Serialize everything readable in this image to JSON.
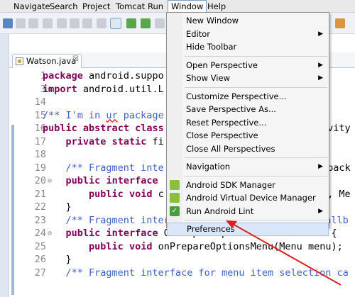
{
  "menubar": {
    "items": [
      "Navigate",
      "Search",
      "Project",
      "Tomcat",
      "Run",
      "Window",
      "Help"
    ],
    "active": "Window"
  },
  "editor": {
    "tab_label": "Watson.java",
    "tab_close": "☒",
    "lines": [
      {
        "num": "1",
        "text": "package android.suppo",
        "fold": ""
      },
      {
        "num": "3",
        "text": "import android.util.L",
        "fold": "⊕"
      },
      {
        "num": "14",
        "text": "",
        "fold": ""
      },
      {
        "num": "15",
        "text": "/** I'm in ur package",
        "fold": ""
      },
      {
        "num": "16",
        "text": "public abstract class",
        "fold": ""
      },
      {
        "num": "17",
        "text": "    private static fi",
        "fold": ""
      },
      {
        "num": "18",
        "text": "",
        "fold": ""
      },
      {
        "num": "19",
        "text": "    /** Fragment inte",
        "fold": ""
      },
      {
        "num": "20",
        "text": "    public interface",
        "fold": "⊖"
      },
      {
        "num": "21",
        "text": "        public void c",
        "fold": ""
      },
      {
        "num": "22",
        "text": "    }",
        "fold": ""
      },
      {
        "num": "23",
        "text": "    /** Fragment interface for menu preparation callb",
        "fold": ""
      },
      {
        "num": "24",
        "text": "    public interface OnPrepareOptionsMenuListener {",
        "fold": "⊖"
      },
      {
        "num": "25",
        "text": "        public void onPrepareOptionsMenu(Menu menu);",
        "fold": ""
      },
      {
        "num": "26",
        "text": "    }",
        "fold": ""
      },
      {
        "num": "27",
        "text": "    /** Fragment interface for menu item selection ca",
        "fold": ""
      }
    ],
    "right_fragments": [
      "ivity",
      "lback",
      "{",
      "u, Me"
    ]
  },
  "window_menu": {
    "groups": [
      [
        {
          "label": "New Window",
          "submenu": false,
          "icon": ""
        },
        {
          "label": "Editor",
          "submenu": true,
          "icon": ""
        },
        {
          "label": "Hide Toolbar",
          "submenu": false,
          "icon": ""
        }
      ],
      [
        {
          "label": "Open Perspective",
          "submenu": true,
          "icon": ""
        },
        {
          "label": "Show View",
          "submenu": true,
          "icon": ""
        }
      ],
      [
        {
          "label": "Customize Perspective...",
          "submenu": false,
          "icon": ""
        },
        {
          "label": "Save Perspective As...",
          "submenu": false,
          "icon": ""
        },
        {
          "label": "Reset Perspective...",
          "submenu": false,
          "icon": ""
        },
        {
          "label": "Close Perspective",
          "submenu": false,
          "icon": ""
        },
        {
          "label": "Close All Perspectives",
          "submenu": false,
          "icon": ""
        }
      ],
      [
        {
          "label": "Navigation",
          "submenu": true,
          "icon": ""
        }
      ],
      [
        {
          "label": "Android SDK Manager",
          "submenu": false,
          "icon": "android-sdk-icon"
        },
        {
          "label": "Android Virtual Device Manager",
          "submenu": false,
          "icon": "android-avd-icon"
        },
        {
          "label": "Run Android Lint",
          "submenu": true,
          "icon": "lint-check-icon"
        }
      ],
      [
        {
          "label": "Preferences",
          "submenu": false,
          "icon": "",
          "highlighted": true
        }
      ]
    ],
    "submenu_arrow": "▶"
  },
  "colors": {
    "keyword": "#7f0055",
    "comment": "#3f5fbf",
    "menu_highlight": "#dbe7f8",
    "annotation_arrow": "#e02020"
  }
}
